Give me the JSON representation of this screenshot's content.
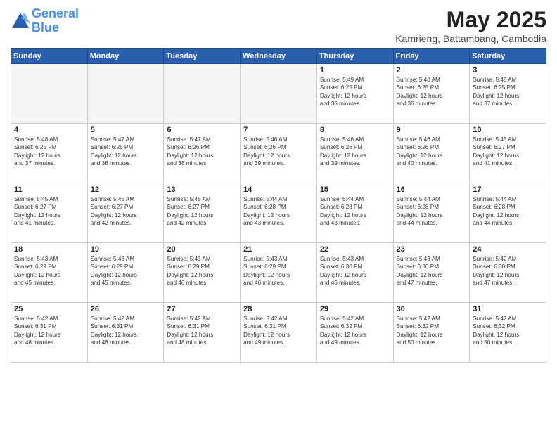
{
  "header": {
    "logo_line1": "General",
    "logo_line2": "Blue",
    "month_title": "May 2025",
    "subtitle": "Kamrieng, Battambang, Cambodia"
  },
  "weekdays": [
    "Sunday",
    "Monday",
    "Tuesday",
    "Wednesday",
    "Thursday",
    "Friday",
    "Saturday"
  ],
  "weeks": [
    [
      {
        "day": "",
        "info": ""
      },
      {
        "day": "",
        "info": ""
      },
      {
        "day": "",
        "info": ""
      },
      {
        "day": "",
        "info": ""
      },
      {
        "day": "1",
        "info": "Sunrise: 5:49 AM\nSunset: 6:25 PM\nDaylight: 12 hours\nand 35 minutes."
      },
      {
        "day": "2",
        "info": "Sunrise: 5:48 AM\nSunset: 6:25 PM\nDaylight: 12 hours\nand 36 minutes."
      },
      {
        "day": "3",
        "info": "Sunrise: 5:48 AM\nSunset: 6:25 PM\nDaylight: 12 hours\nand 37 minutes."
      }
    ],
    [
      {
        "day": "4",
        "info": "Sunrise: 5:48 AM\nSunset: 6:25 PM\nDaylight: 12 hours\nand 37 minutes."
      },
      {
        "day": "5",
        "info": "Sunrise: 5:47 AM\nSunset: 6:25 PM\nDaylight: 12 hours\nand 38 minutes."
      },
      {
        "day": "6",
        "info": "Sunrise: 5:47 AM\nSunset: 6:26 PM\nDaylight: 12 hours\nand 38 minutes."
      },
      {
        "day": "7",
        "info": "Sunrise: 5:46 AM\nSunset: 6:26 PM\nDaylight: 12 hours\nand 39 minutes."
      },
      {
        "day": "8",
        "info": "Sunrise: 5:46 AM\nSunset: 6:26 PM\nDaylight: 12 hours\nand 39 minutes."
      },
      {
        "day": "9",
        "info": "Sunrise: 5:46 AM\nSunset: 6:26 PM\nDaylight: 12 hours\nand 40 minutes."
      },
      {
        "day": "10",
        "info": "Sunrise: 5:45 AM\nSunset: 6:27 PM\nDaylight: 12 hours\nand 41 minutes."
      }
    ],
    [
      {
        "day": "11",
        "info": "Sunrise: 5:45 AM\nSunset: 6:27 PM\nDaylight: 12 hours\nand 41 minutes."
      },
      {
        "day": "12",
        "info": "Sunrise: 5:45 AM\nSunset: 6:27 PM\nDaylight: 12 hours\nand 42 minutes."
      },
      {
        "day": "13",
        "info": "Sunrise: 5:45 AM\nSunset: 6:27 PM\nDaylight: 12 hours\nand 42 minutes."
      },
      {
        "day": "14",
        "info": "Sunrise: 5:44 AM\nSunset: 6:28 PM\nDaylight: 12 hours\nand 43 minutes."
      },
      {
        "day": "15",
        "info": "Sunrise: 5:44 AM\nSunset: 6:28 PM\nDaylight: 12 hours\nand 43 minutes."
      },
      {
        "day": "16",
        "info": "Sunrise: 5:44 AM\nSunset: 6:28 PM\nDaylight: 12 hours\nand 44 minutes."
      },
      {
        "day": "17",
        "info": "Sunrise: 5:44 AM\nSunset: 6:28 PM\nDaylight: 12 hours\nand 44 minutes."
      }
    ],
    [
      {
        "day": "18",
        "info": "Sunrise: 5:43 AM\nSunset: 6:29 PM\nDaylight: 12 hours\nand 45 minutes."
      },
      {
        "day": "19",
        "info": "Sunrise: 5:43 AM\nSunset: 6:29 PM\nDaylight: 12 hours\nand 45 minutes."
      },
      {
        "day": "20",
        "info": "Sunrise: 5:43 AM\nSunset: 6:29 PM\nDaylight: 12 hours\nand 46 minutes."
      },
      {
        "day": "21",
        "info": "Sunrise: 5:43 AM\nSunset: 6:29 PM\nDaylight: 12 hours\nand 46 minutes."
      },
      {
        "day": "22",
        "info": "Sunrise: 5:43 AM\nSunset: 6:30 PM\nDaylight: 12 hours\nand 46 minutes."
      },
      {
        "day": "23",
        "info": "Sunrise: 5:43 AM\nSunset: 6:30 PM\nDaylight: 12 hours\nand 47 minutes."
      },
      {
        "day": "24",
        "info": "Sunrise: 5:42 AM\nSunset: 6:30 PM\nDaylight: 12 hours\nand 47 minutes."
      }
    ],
    [
      {
        "day": "25",
        "info": "Sunrise: 5:42 AM\nSunset: 6:31 PM\nDaylight: 12 hours\nand 48 minutes."
      },
      {
        "day": "26",
        "info": "Sunrise: 5:42 AM\nSunset: 6:31 PM\nDaylight: 12 hours\nand 48 minutes."
      },
      {
        "day": "27",
        "info": "Sunrise: 5:42 AM\nSunset: 6:31 PM\nDaylight: 12 hours\nand 48 minutes."
      },
      {
        "day": "28",
        "info": "Sunrise: 5:42 AM\nSunset: 6:31 PM\nDaylight: 12 hours\nand 49 minutes."
      },
      {
        "day": "29",
        "info": "Sunrise: 5:42 AM\nSunset: 6:32 PM\nDaylight: 12 hours\nand 49 minutes."
      },
      {
        "day": "30",
        "info": "Sunrise: 5:42 AM\nSunset: 6:32 PM\nDaylight: 12 hours\nand 50 minutes."
      },
      {
        "day": "31",
        "info": "Sunrise: 5:42 AM\nSunset: 6:32 PM\nDaylight: 12 hours\nand 50 minutes."
      }
    ]
  ]
}
